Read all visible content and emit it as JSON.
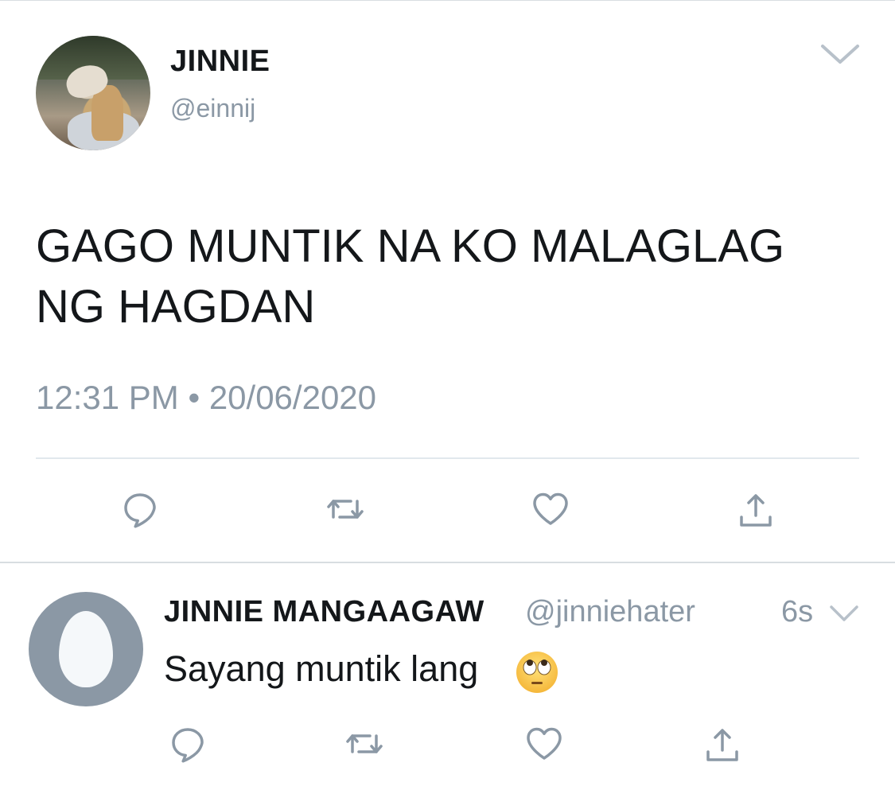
{
  "tweet": {
    "author_name": "JINNIE",
    "author_handle": "@einnij",
    "text": "GAGO MUNTIK NA KO MALAGLAG NG HAGDAN",
    "timestamp": "12:31 PM • 20/06/2020"
  },
  "reply": {
    "author_name": "JINNIE MANGAAGAW",
    "author_handle": "@jinniehater",
    "time_ago": "6s",
    "text": "Sayang muntik lang",
    "emoji": "face-with-rolling-eyes"
  },
  "actions": [
    "reply-icon",
    "retweet-icon",
    "like-icon",
    "share-icon"
  ],
  "colors": {
    "text_primary": "#14171a",
    "text_secondary": "#8b98a5",
    "icon": "#8b98a5",
    "divider": "#e1e8ed",
    "default_avatar": "#8b98a5"
  }
}
